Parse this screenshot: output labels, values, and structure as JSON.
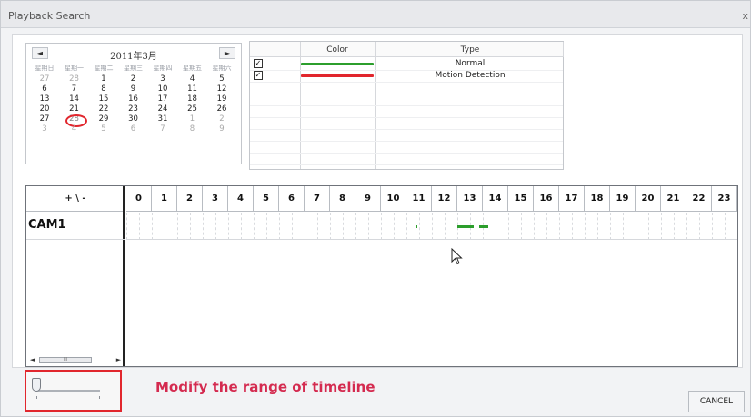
{
  "window": {
    "title": "Playback Search",
    "close_label": "x"
  },
  "calendar": {
    "title": "2011年3月",
    "prev_label": "◄",
    "next_label": "►",
    "weekdays": [
      "星期日",
      "星期一",
      "星期二",
      "星期三",
      "星期四",
      "星期五",
      "星期六"
    ],
    "weeks": [
      [
        {
          "d": "27",
          "o": true
        },
        {
          "d": "28",
          "o": true
        },
        {
          "d": "1"
        },
        {
          "d": "2"
        },
        {
          "d": "3"
        },
        {
          "d": "4"
        },
        {
          "d": "5"
        }
      ],
      [
        {
          "d": "6"
        },
        {
          "d": "7"
        },
        {
          "d": "8"
        },
        {
          "d": "9"
        },
        {
          "d": "10"
        },
        {
          "d": "11"
        },
        {
          "d": "12"
        }
      ],
      [
        {
          "d": "13"
        },
        {
          "d": "14"
        },
        {
          "d": "15"
        },
        {
          "d": "16"
        },
        {
          "d": "17"
        },
        {
          "d": "18"
        },
        {
          "d": "19"
        }
      ],
      [
        {
          "d": "20"
        },
        {
          "d": "21"
        },
        {
          "d": "22"
        },
        {
          "d": "23"
        },
        {
          "d": "24"
        },
        {
          "d": "25"
        },
        {
          "d": "26"
        }
      ],
      [
        {
          "d": "27"
        },
        {
          "d": "28",
          "sel": true
        },
        {
          "d": "29"
        },
        {
          "d": "30"
        },
        {
          "d": "31"
        },
        {
          "d": "1",
          "o": true
        },
        {
          "d": "2",
          "o": true
        }
      ],
      [
        {
          "d": "3",
          "o": true
        },
        {
          "d": "4",
          "o": true
        },
        {
          "d": "5",
          "o": true
        },
        {
          "d": "6",
          "o": true
        },
        {
          "d": "7",
          "o": true
        },
        {
          "d": "8",
          "o": true
        },
        {
          "d": "9",
          "o": true
        }
      ]
    ]
  },
  "legend": {
    "headers": {
      "color": "Color",
      "type": "Type"
    },
    "rows": [
      {
        "checked": true,
        "color": "#2c9e2c",
        "type": "Normal"
      },
      {
        "checked": true,
        "color": "#e1262d",
        "type": "Motion Detection"
      }
    ]
  },
  "timeline": {
    "zoom_label": "+ \\ -",
    "camera": "CAM1",
    "hours": [
      "0",
      "1",
      "2",
      "3",
      "4",
      "5",
      "6",
      "7",
      "8",
      "9",
      "10",
      "11",
      "12",
      "13",
      "14",
      "15",
      "16",
      "17",
      "18",
      "19",
      "20",
      "21",
      "22",
      "23"
    ],
    "record_color": "#2c9e2c",
    "recordings": [
      {
        "start_hour": 11.35,
        "end_hour": 11.42
      },
      {
        "start_hour": 13.0,
        "end_hour": 13.65
      },
      {
        "start_hour": 13.85,
        "end_hour": 14.2
      }
    ],
    "scrollbar": {
      "left_label": "◄",
      "right_label": "►",
      "thumb_label": "III"
    }
  },
  "annotation": "Modify the range of timeline",
  "buttons": {
    "cancel": "CANCEL"
  }
}
